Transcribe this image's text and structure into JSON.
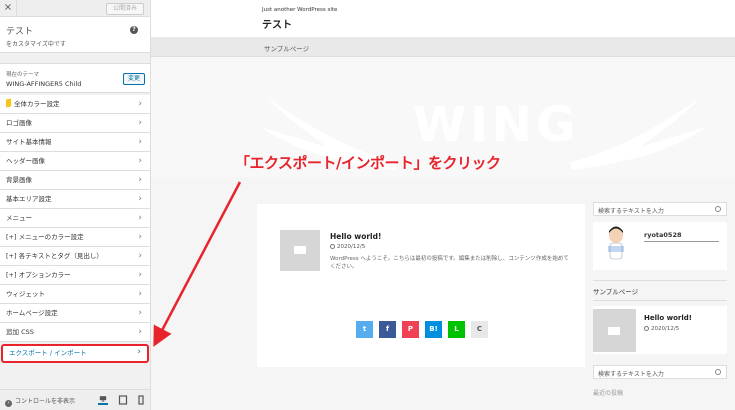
{
  "sidebar": {
    "close_label": "×",
    "publish_label": "公開済み",
    "title": "テスト",
    "subtitle": "をカスタマイズ中です",
    "help_label": "?",
    "theme_caption": "現在のテーマ",
    "theme_name": "WING-AFFINGER5 Child",
    "change_label": "変更",
    "items": [
      {
        "label": "全体カラー設定"
      },
      {
        "label": "ロゴ画像"
      },
      {
        "label": "サイト基本情報"
      },
      {
        "label": "ヘッダー画像"
      },
      {
        "label": "背景画像"
      },
      {
        "label": "基本エリア設定"
      },
      {
        "label": "メニュー"
      },
      {
        "label": "[+] メニューのカラー設定"
      },
      {
        "label": "[+] 各テキストとタグ（見出し）"
      },
      {
        "label": "[+] オプションカラー"
      },
      {
        "label": "ウィジェット"
      },
      {
        "label": "ホームページ設定"
      },
      {
        "label": "追加 CSS"
      },
      {
        "label": "エクスポート / インポート"
      }
    ],
    "hide_controls_label": "コントロールを非表示",
    "chevron": "›"
  },
  "preview": {
    "tagline": "Just another WordPress site",
    "site_title": "テスト",
    "nav_item": "サンプルページ",
    "hero_word": "WING",
    "post": {
      "title": "Hello world!",
      "date": "2020/12/5",
      "excerpt": "WordPress へようこそ。こちらは最初の投稿です。編集または削除し、コンテンツ作成を始めてください。"
    },
    "shares": [
      "t",
      "f",
      "P",
      "B!",
      "L",
      "C"
    ],
    "aside": {
      "search_placeholder": "検索するテキストを入力",
      "username": "ryota0528",
      "page_link": "サンプルページ",
      "recent_title": "Hello world!",
      "recent_date": "2020/12/5",
      "popular_heading": "最近の投稿"
    }
  },
  "annotation": "「エクスポート/インポート」をクリック",
  "colors": {
    "accent": "#0073aa",
    "highlight": "#e8232b",
    "twitter": "#55acee",
    "facebook": "#3b5998",
    "pocket": "#ef4056",
    "hatena": "#008fde",
    "line": "#00c300"
  }
}
